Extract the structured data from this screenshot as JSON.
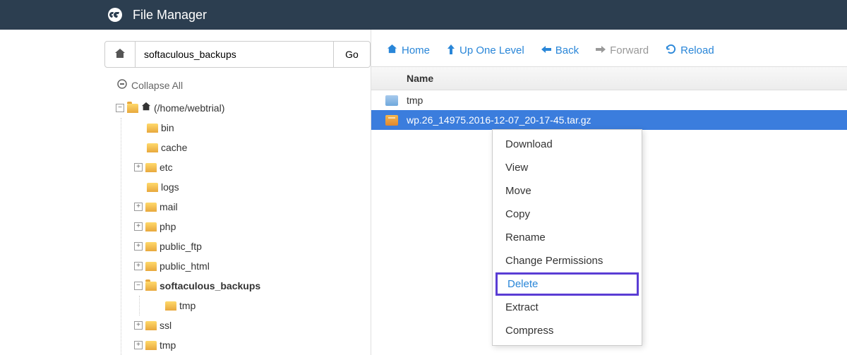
{
  "header": {
    "title": "File Manager"
  },
  "pathbar": {
    "value": "softaculous_backups",
    "go_label": "Go"
  },
  "collapse_label": "Collapse All",
  "toolbar": {
    "home": "Home",
    "up": "Up One Level",
    "back": "Back",
    "forward": "Forward",
    "reload": "Reload"
  },
  "tree": {
    "root_label": "(/home/webtrial)",
    "items": [
      {
        "label": "bin",
        "expandable": false
      },
      {
        "label": "cache",
        "expandable": false
      },
      {
        "label": "etc",
        "expandable": true
      },
      {
        "label": "logs",
        "expandable": false
      },
      {
        "label": "mail",
        "expandable": true
      },
      {
        "label": "php",
        "expandable": true
      },
      {
        "label": "public_ftp",
        "expandable": true
      },
      {
        "label": "public_html",
        "expandable": true
      },
      {
        "label": "softaculous_backups",
        "expandable": true,
        "bold": true,
        "expanded": true,
        "children": [
          {
            "label": "tmp"
          }
        ]
      },
      {
        "label": "ssl",
        "expandable": true
      },
      {
        "label": "tmp",
        "expandable": true
      }
    ]
  },
  "table": {
    "header_name": "Name",
    "rows": [
      {
        "name": "tmp",
        "type": "folder"
      },
      {
        "name": "wp.26_14975.2016-12-07_20-17-45.tar.gz",
        "type": "archive",
        "selected": true
      }
    ]
  },
  "context_menu": {
    "items": [
      "Download",
      "View",
      "Move",
      "Copy",
      "Rename",
      "Change Permissions",
      "Delete",
      "Extract",
      "Compress"
    ],
    "highlighted_index": 6
  }
}
